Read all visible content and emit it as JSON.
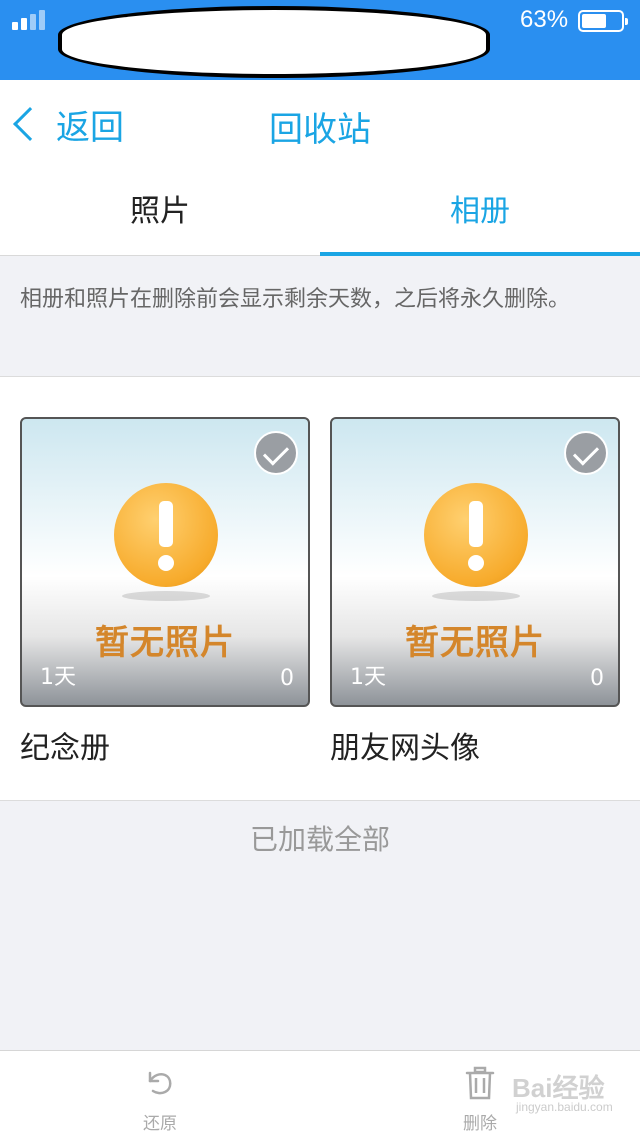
{
  "status_bar": {
    "battery_text": "63%",
    "battery_level": 0.63
  },
  "nav": {
    "back_label": "返回",
    "title": "回收站"
  },
  "tabs": [
    {
      "label": "照片",
      "active": false
    },
    {
      "label": "相册",
      "active": true
    }
  ],
  "info_text": "相册和照片在删除前会显示剩余天数，之后将永久删除。",
  "albums": [
    {
      "name": "纪念册",
      "cover_text": "暂无照片",
      "days": "1天",
      "count": "0",
      "selected": true
    },
    {
      "name": "朋友网头像",
      "cover_text": "暂无照片",
      "days": "1天",
      "count": "0",
      "selected": true
    }
  ],
  "loaded_text": "已加载全部",
  "toolbar": {
    "restore_label": "还原",
    "delete_label": "删除"
  },
  "watermark": {
    "text": "Bai经验",
    "sub": "jingyan.baidu.com"
  },
  "colors": {
    "status_bar": "#2a8ff0",
    "accent": "#1aa5e4",
    "warning_orange": "#f7ab2c",
    "background": "#f1f2f6"
  }
}
